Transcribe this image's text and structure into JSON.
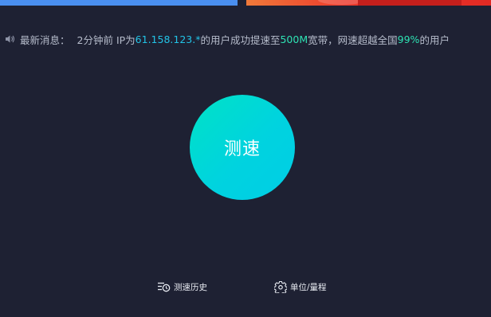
{
  "news": {
    "label": "最新消息：",
    "prefix": "2分钟前 IP为",
    "ip": "61.158.123.*",
    "middle": "的用户成功提速至",
    "speed": "500M",
    "after_speed": "宽带，网速超越全国",
    "percent": "99%",
    "suffix": "的用户"
  },
  "main": {
    "speed_button_label": "测速"
  },
  "footer": {
    "history_label": "测速历史",
    "unit_label": "单位/量程"
  },
  "colors": {
    "background": "#1e2133",
    "ip_highlight": "#22c3e6",
    "value_highlight": "#2ee3b4",
    "button_gradient_start": "#00e2c6",
    "button_gradient_end": "#00cde6",
    "banner_left": "#4a8ff0",
    "banner_right": "#ec3a2c"
  },
  "icons": {
    "news": "speaker-icon",
    "history": "history-list-icon",
    "unit": "gear-icon"
  }
}
